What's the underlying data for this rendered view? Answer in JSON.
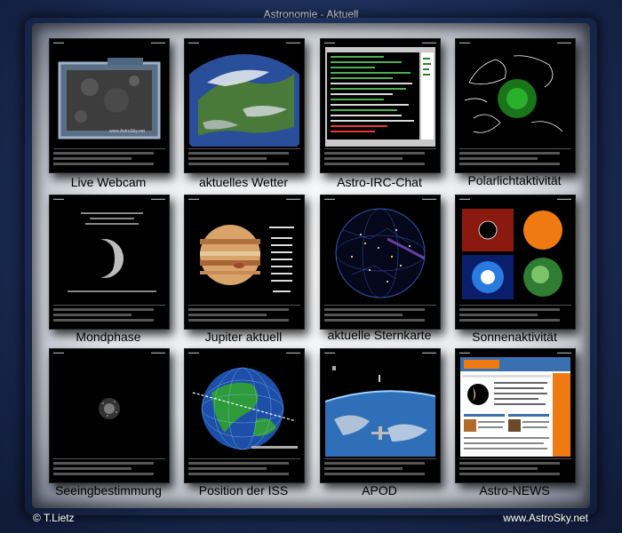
{
  "page": {
    "title": "Astronomie - Aktuell"
  },
  "tiles": [
    {
      "label": "Live Webcam",
      "icon": "moon-webcam-icon",
      "watermark": "www.AstroSky.net"
    },
    {
      "label": "aktuelles Wetter",
      "icon": "earth-weather-icon"
    },
    {
      "label": "Astro-IRC-Chat",
      "icon": "chat-window-icon"
    },
    {
      "label": "Polarlichtaktivität",
      "icon": "aurora-map-icon"
    },
    {
      "label": "Mondphase",
      "icon": "moon-phase-icon"
    },
    {
      "label": "Jupiter aktuell",
      "icon": "jupiter-icon"
    },
    {
      "label": "aktuelle Sternkarte",
      "icon": "star-chart-icon"
    },
    {
      "label": "Sonnenaktivität",
      "icon": "sun-activity-icon"
    },
    {
      "label": "Seeingbestimmung",
      "icon": "seeing-star-icon"
    },
    {
      "label": "Position der ISS",
      "icon": "iss-globe-icon"
    },
    {
      "label": "APOD",
      "icon": "earth-orbit-photo-icon"
    },
    {
      "label": "Astro-NEWS",
      "icon": "news-page-icon"
    }
  ],
  "footer": {
    "copyright": "© T.Lietz",
    "site": "www.AstroSky.net"
  },
  "colors": {
    "background": "#1b2b4e",
    "panel": "#e8ebf0",
    "tile": "#000000",
    "earth_green": "#2e7d32",
    "ocean_blue": "#1e4fa8",
    "sun_orange": "#f07a12"
  }
}
